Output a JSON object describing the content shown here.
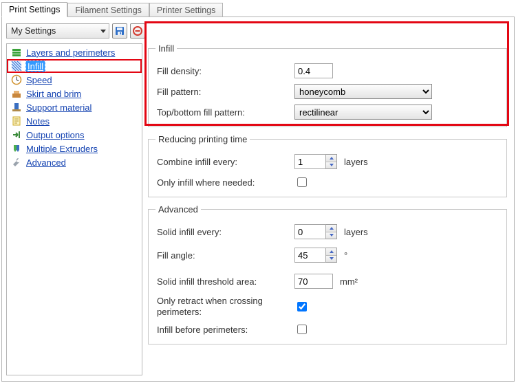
{
  "tabs": {
    "print": "Print Settings",
    "filament": "Filament Settings",
    "printer": "Printer Settings"
  },
  "preset": "My Settings",
  "sidebar": {
    "items": [
      {
        "label": "Layers and perimeters"
      },
      {
        "label": "Infill"
      },
      {
        "label": "Speed"
      },
      {
        "label": "Skirt and brim"
      },
      {
        "label": "Support material"
      },
      {
        "label": "Notes"
      },
      {
        "label": "Output options"
      },
      {
        "label": "Multiple Extruders"
      },
      {
        "label": "Advanced"
      }
    ]
  },
  "groups": {
    "infill": {
      "legend": "Infill",
      "fill_density": {
        "label": "Fill density:",
        "value": "0.4"
      },
      "fill_pattern": {
        "label": "Fill pattern:",
        "value": "honeycomb"
      },
      "top_bottom": {
        "label": "Top/bottom fill pattern:",
        "value": "rectilinear"
      }
    },
    "reducing": {
      "legend": "Reducing printing time",
      "combine_every": {
        "label": "Combine infill every:",
        "value": "1",
        "unit": "layers"
      },
      "only_where": {
        "label": "Only infill where needed:",
        "checked": false
      }
    },
    "advanced": {
      "legend": "Advanced",
      "solid_every": {
        "label": "Solid infill every:",
        "value": "0",
        "unit": "layers"
      },
      "fill_angle": {
        "label": "Fill angle:",
        "value": "45",
        "unit": "°"
      },
      "threshold": {
        "label": "Solid infill threshold area:",
        "value": "70",
        "unit": "mm²"
      },
      "retract_cross": {
        "label": "Only retract when crossing perimeters:",
        "checked": true
      },
      "infill_before": {
        "label": "Infill before perimeters:",
        "checked": false
      }
    }
  }
}
